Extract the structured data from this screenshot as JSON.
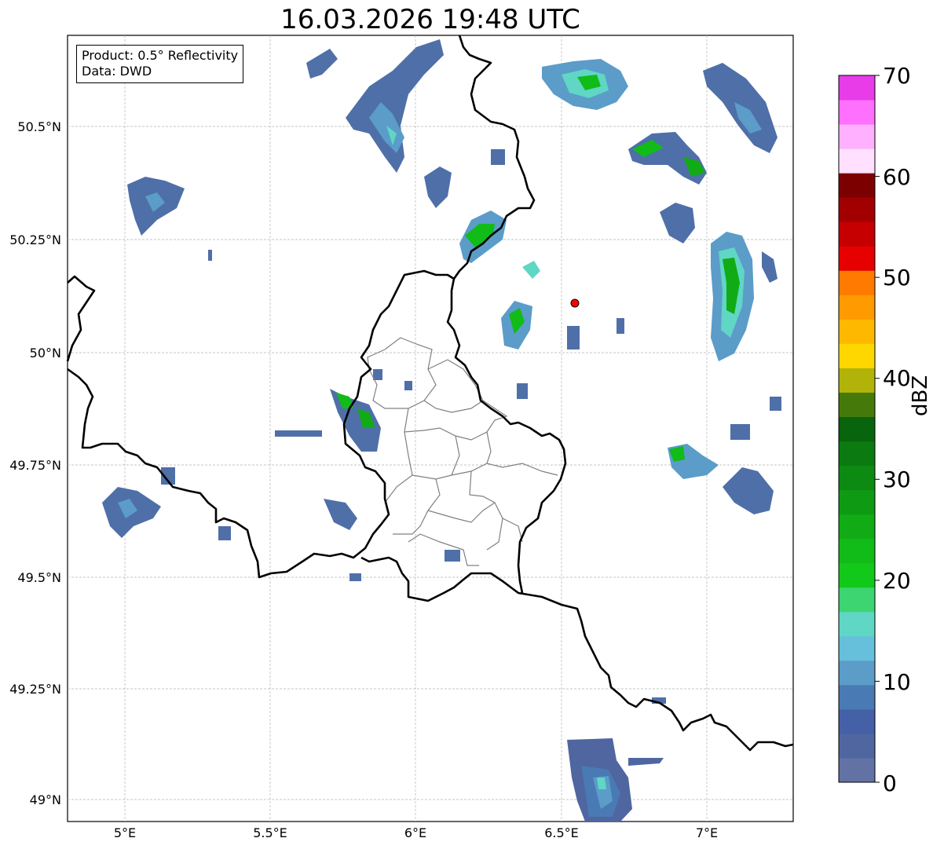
{
  "title": "16.03.2026 19:48 UTC",
  "info": {
    "product_line": "Product: 0.5° Reflectivity",
    "data_line": "Data: DWD"
  },
  "map": {
    "lat_labels": [
      "50.5°N",
      "50.25°N",
      "50°N",
      "49.75°N",
      "49.5°N",
      "49.25°N",
      "49°N"
    ],
    "lon_labels": [
      "5°E",
      "5.5°E",
      "6°E",
      "6.5°E",
      "7°E"
    ],
    "radar_site_color": "#ff0000",
    "border_color": "#000000",
    "district_border_color": "#808080"
  },
  "colorbar": {
    "label": "dBZ",
    "ticks": [
      "0",
      "10",
      "20",
      "30",
      "40",
      "50",
      "60",
      "70"
    ],
    "colors": [
      "#6272a4",
      "#4f66a0",
      "#4460a6",
      "#4a7ab4",
      "#5b9cc9",
      "#66c0dc",
      "#60d6c4",
      "#3dd472",
      "#12c91a",
      "#11bb18",
      "#11ab16",
      "#0f9a14",
      "#0d8a12",
      "#0b7a10",
      "#08640d",
      "#457a0b",
      "#b2b308",
      "#ffd700",
      "#ffb800",
      "#ff9a00",
      "#ff7a00",
      "#e60000",
      "#c60000",
      "#a20000",
      "#7d0000",
      "#ffe0ff",
      "#ffb0ff",
      "#ff70ff",
      "#e83ce8"
    ]
  }
}
